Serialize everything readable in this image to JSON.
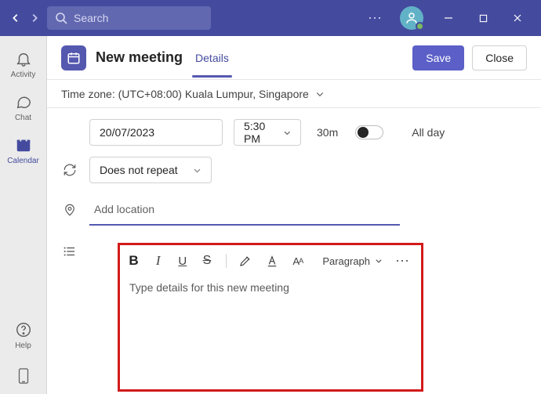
{
  "titlebar": {
    "search_placeholder": "Search"
  },
  "rail": {
    "activity": "Activity",
    "chat": "Chat",
    "calendar": "Calendar",
    "help": "Help"
  },
  "header": {
    "title": "New meeting",
    "tab_details": "Details",
    "save": "Save",
    "close": "Close"
  },
  "timezone": {
    "label": "Time zone: (UTC+08:00) Kuala Lumpur, Singapore"
  },
  "schedule": {
    "date": "20/07/2023",
    "time": "5:30 PM",
    "duration": "30m",
    "allday": "All day"
  },
  "repeat": {
    "value": "Does not repeat"
  },
  "location": {
    "placeholder": "Add location"
  },
  "editor": {
    "paragraph": "Paragraph",
    "placeholder": "Type details for this new meeting"
  }
}
